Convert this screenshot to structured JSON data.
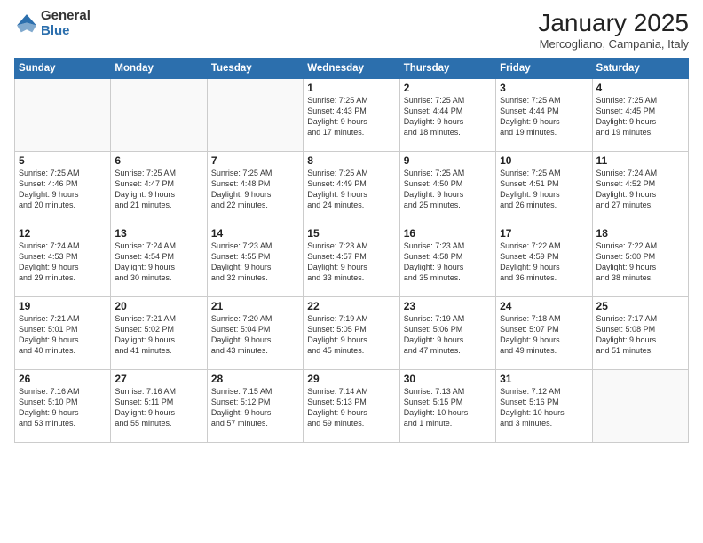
{
  "header": {
    "logo_general": "General",
    "logo_blue": "Blue",
    "month_title": "January 2025",
    "location": "Mercogliano, Campania, Italy"
  },
  "weekdays": [
    "Sunday",
    "Monday",
    "Tuesday",
    "Wednesday",
    "Thursday",
    "Friday",
    "Saturday"
  ],
  "weeks": [
    [
      {
        "num": "",
        "lines": []
      },
      {
        "num": "",
        "lines": []
      },
      {
        "num": "",
        "lines": []
      },
      {
        "num": "1",
        "lines": [
          "Sunrise: 7:25 AM",
          "Sunset: 4:43 PM",
          "Daylight: 9 hours",
          "and 17 minutes."
        ]
      },
      {
        "num": "2",
        "lines": [
          "Sunrise: 7:25 AM",
          "Sunset: 4:44 PM",
          "Daylight: 9 hours",
          "and 18 minutes."
        ]
      },
      {
        "num": "3",
        "lines": [
          "Sunrise: 7:25 AM",
          "Sunset: 4:44 PM",
          "Daylight: 9 hours",
          "and 19 minutes."
        ]
      },
      {
        "num": "4",
        "lines": [
          "Sunrise: 7:25 AM",
          "Sunset: 4:45 PM",
          "Daylight: 9 hours",
          "and 19 minutes."
        ]
      }
    ],
    [
      {
        "num": "5",
        "lines": [
          "Sunrise: 7:25 AM",
          "Sunset: 4:46 PM",
          "Daylight: 9 hours",
          "and 20 minutes."
        ]
      },
      {
        "num": "6",
        "lines": [
          "Sunrise: 7:25 AM",
          "Sunset: 4:47 PM",
          "Daylight: 9 hours",
          "and 21 minutes."
        ]
      },
      {
        "num": "7",
        "lines": [
          "Sunrise: 7:25 AM",
          "Sunset: 4:48 PM",
          "Daylight: 9 hours",
          "and 22 minutes."
        ]
      },
      {
        "num": "8",
        "lines": [
          "Sunrise: 7:25 AM",
          "Sunset: 4:49 PM",
          "Daylight: 9 hours",
          "and 24 minutes."
        ]
      },
      {
        "num": "9",
        "lines": [
          "Sunrise: 7:25 AM",
          "Sunset: 4:50 PM",
          "Daylight: 9 hours",
          "and 25 minutes."
        ]
      },
      {
        "num": "10",
        "lines": [
          "Sunrise: 7:25 AM",
          "Sunset: 4:51 PM",
          "Daylight: 9 hours",
          "and 26 minutes."
        ]
      },
      {
        "num": "11",
        "lines": [
          "Sunrise: 7:24 AM",
          "Sunset: 4:52 PM",
          "Daylight: 9 hours",
          "and 27 minutes."
        ]
      }
    ],
    [
      {
        "num": "12",
        "lines": [
          "Sunrise: 7:24 AM",
          "Sunset: 4:53 PM",
          "Daylight: 9 hours",
          "and 29 minutes."
        ]
      },
      {
        "num": "13",
        "lines": [
          "Sunrise: 7:24 AM",
          "Sunset: 4:54 PM",
          "Daylight: 9 hours",
          "and 30 minutes."
        ]
      },
      {
        "num": "14",
        "lines": [
          "Sunrise: 7:23 AM",
          "Sunset: 4:55 PM",
          "Daylight: 9 hours",
          "and 32 minutes."
        ]
      },
      {
        "num": "15",
        "lines": [
          "Sunrise: 7:23 AM",
          "Sunset: 4:57 PM",
          "Daylight: 9 hours",
          "and 33 minutes."
        ]
      },
      {
        "num": "16",
        "lines": [
          "Sunrise: 7:23 AM",
          "Sunset: 4:58 PM",
          "Daylight: 9 hours",
          "and 35 minutes."
        ]
      },
      {
        "num": "17",
        "lines": [
          "Sunrise: 7:22 AM",
          "Sunset: 4:59 PM",
          "Daylight: 9 hours",
          "and 36 minutes."
        ]
      },
      {
        "num": "18",
        "lines": [
          "Sunrise: 7:22 AM",
          "Sunset: 5:00 PM",
          "Daylight: 9 hours",
          "and 38 minutes."
        ]
      }
    ],
    [
      {
        "num": "19",
        "lines": [
          "Sunrise: 7:21 AM",
          "Sunset: 5:01 PM",
          "Daylight: 9 hours",
          "and 40 minutes."
        ]
      },
      {
        "num": "20",
        "lines": [
          "Sunrise: 7:21 AM",
          "Sunset: 5:02 PM",
          "Daylight: 9 hours",
          "and 41 minutes."
        ]
      },
      {
        "num": "21",
        "lines": [
          "Sunrise: 7:20 AM",
          "Sunset: 5:04 PM",
          "Daylight: 9 hours",
          "and 43 minutes."
        ]
      },
      {
        "num": "22",
        "lines": [
          "Sunrise: 7:19 AM",
          "Sunset: 5:05 PM",
          "Daylight: 9 hours",
          "and 45 minutes."
        ]
      },
      {
        "num": "23",
        "lines": [
          "Sunrise: 7:19 AM",
          "Sunset: 5:06 PM",
          "Daylight: 9 hours",
          "and 47 minutes."
        ]
      },
      {
        "num": "24",
        "lines": [
          "Sunrise: 7:18 AM",
          "Sunset: 5:07 PM",
          "Daylight: 9 hours",
          "and 49 minutes."
        ]
      },
      {
        "num": "25",
        "lines": [
          "Sunrise: 7:17 AM",
          "Sunset: 5:08 PM",
          "Daylight: 9 hours",
          "and 51 minutes."
        ]
      }
    ],
    [
      {
        "num": "26",
        "lines": [
          "Sunrise: 7:16 AM",
          "Sunset: 5:10 PM",
          "Daylight: 9 hours",
          "and 53 minutes."
        ]
      },
      {
        "num": "27",
        "lines": [
          "Sunrise: 7:16 AM",
          "Sunset: 5:11 PM",
          "Daylight: 9 hours",
          "and 55 minutes."
        ]
      },
      {
        "num": "28",
        "lines": [
          "Sunrise: 7:15 AM",
          "Sunset: 5:12 PM",
          "Daylight: 9 hours",
          "and 57 minutes."
        ]
      },
      {
        "num": "29",
        "lines": [
          "Sunrise: 7:14 AM",
          "Sunset: 5:13 PM",
          "Daylight: 9 hours",
          "and 59 minutes."
        ]
      },
      {
        "num": "30",
        "lines": [
          "Sunrise: 7:13 AM",
          "Sunset: 5:15 PM",
          "Daylight: 10 hours",
          "and 1 minute."
        ]
      },
      {
        "num": "31",
        "lines": [
          "Sunrise: 7:12 AM",
          "Sunset: 5:16 PM",
          "Daylight: 10 hours",
          "and 3 minutes."
        ]
      },
      {
        "num": "",
        "lines": []
      }
    ]
  ]
}
